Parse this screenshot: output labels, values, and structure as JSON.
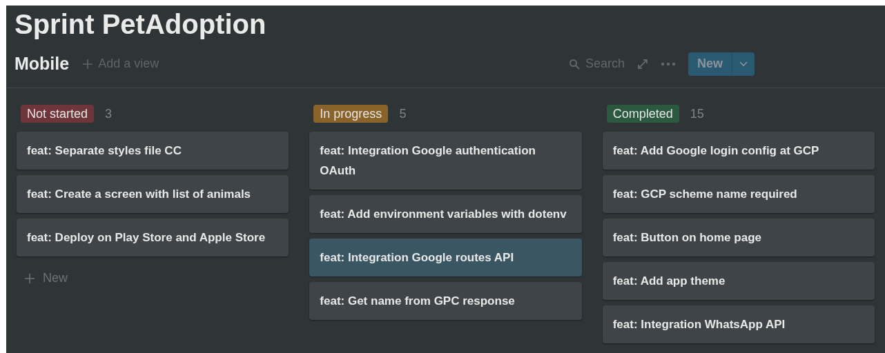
{
  "page_title": "Sprint PetAdoption",
  "view": {
    "name": "Mobile",
    "add_view": "Add a view"
  },
  "toolbar": {
    "search": "Search",
    "new_button": "New"
  },
  "columns": [
    {
      "status": "Not started",
      "color": "#6e363a",
      "count": "3",
      "cards": [
        {
          "title": "feat: Separate styles file CC",
          "selected": false
        },
        {
          "title": "feat: Create a screen with list of animals",
          "selected": false
        },
        {
          "title": "feat: Deploy on Play Store and Apple Store",
          "selected": false
        }
      ],
      "new_label": "New"
    },
    {
      "status": "In progress",
      "color": "#89632a",
      "count": "5",
      "cards": [
        {
          "title": "feat: Integration Google authentication OAuth",
          "selected": false
        },
        {
          "title": "feat: Add environment variables with dotenv",
          "selected": false
        },
        {
          "title": "feat: Integration Google routes API",
          "selected": true
        },
        {
          "title": "feat: Get name from GPC response",
          "selected": false
        }
      ]
    },
    {
      "status": "Completed",
      "color": "#2b593f",
      "count": "15",
      "cards": [
        {
          "title": "feat: Add Google login config at GCP",
          "selected": false
        },
        {
          "title": "feat: GCP scheme name required",
          "selected": false
        },
        {
          "title": "feat: Button on home page",
          "selected": false
        },
        {
          "title": "feat: Add app theme",
          "selected": false
        },
        {
          "title": "feat: Integration WhatsApp API",
          "selected": false
        }
      ]
    }
  ]
}
